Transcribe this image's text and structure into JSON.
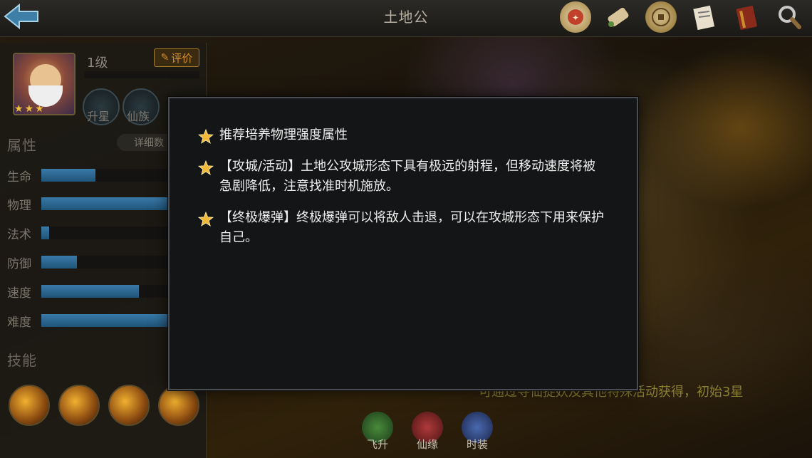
{
  "header": {
    "title": "土地公",
    "icons": [
      "seal-icon",
      "scroll-icon",
      "coin-icon",
      "letter-icon",
      "book-icon",
      "search-icon"
    ]
  },
  "hero": {
    "level": "1级",
    "rate_label": "评价",
    "stars": 3,
    "badges": [
      {
        "label": "升星"
      },
      {
        "label": "仙族"
      }
    ]
  },
  "attributes": {
    "title": "属性",
    "detail_label": "详细数",
    "stats": [
      {
        "label": "生命",
        "value": 0.42
      },
      {
        "label": "物理",
        "value": 1.0
      },
      {
        "label": "法术",
        "value": 0.06
      },
      {
        "label": "防御",
        "value": 0.28
      },
      {
        "label": "速度",
        "value": 0.76
      },
      {
        "label": "难度",
        "value": 1.0
      }
    ]
  },
  "skills": {
    "title": "技能",
    "count": 4
  },
  "bottom_tabs": [
    {
      "label": "飞升"
    },
    {
      "label": "仙缘"
    },
    {
      "label": "时装"
    }
  ],
  "source_note": "可通过寻仙捉妖及其他特殊活动获得，初始3星",
  "modal": {
    "tips": [
      "推荐培养物理强度属性",
      "【攻城/活动】土地公攻城形态下具有极远的射程，但移动速度将被急剧降低，注意找准时机施放。",
      "【终极爆弹】终极爆弹可以将敌人击退，可以在攻城形态下用来保护自己。"
    ]
  }
}
